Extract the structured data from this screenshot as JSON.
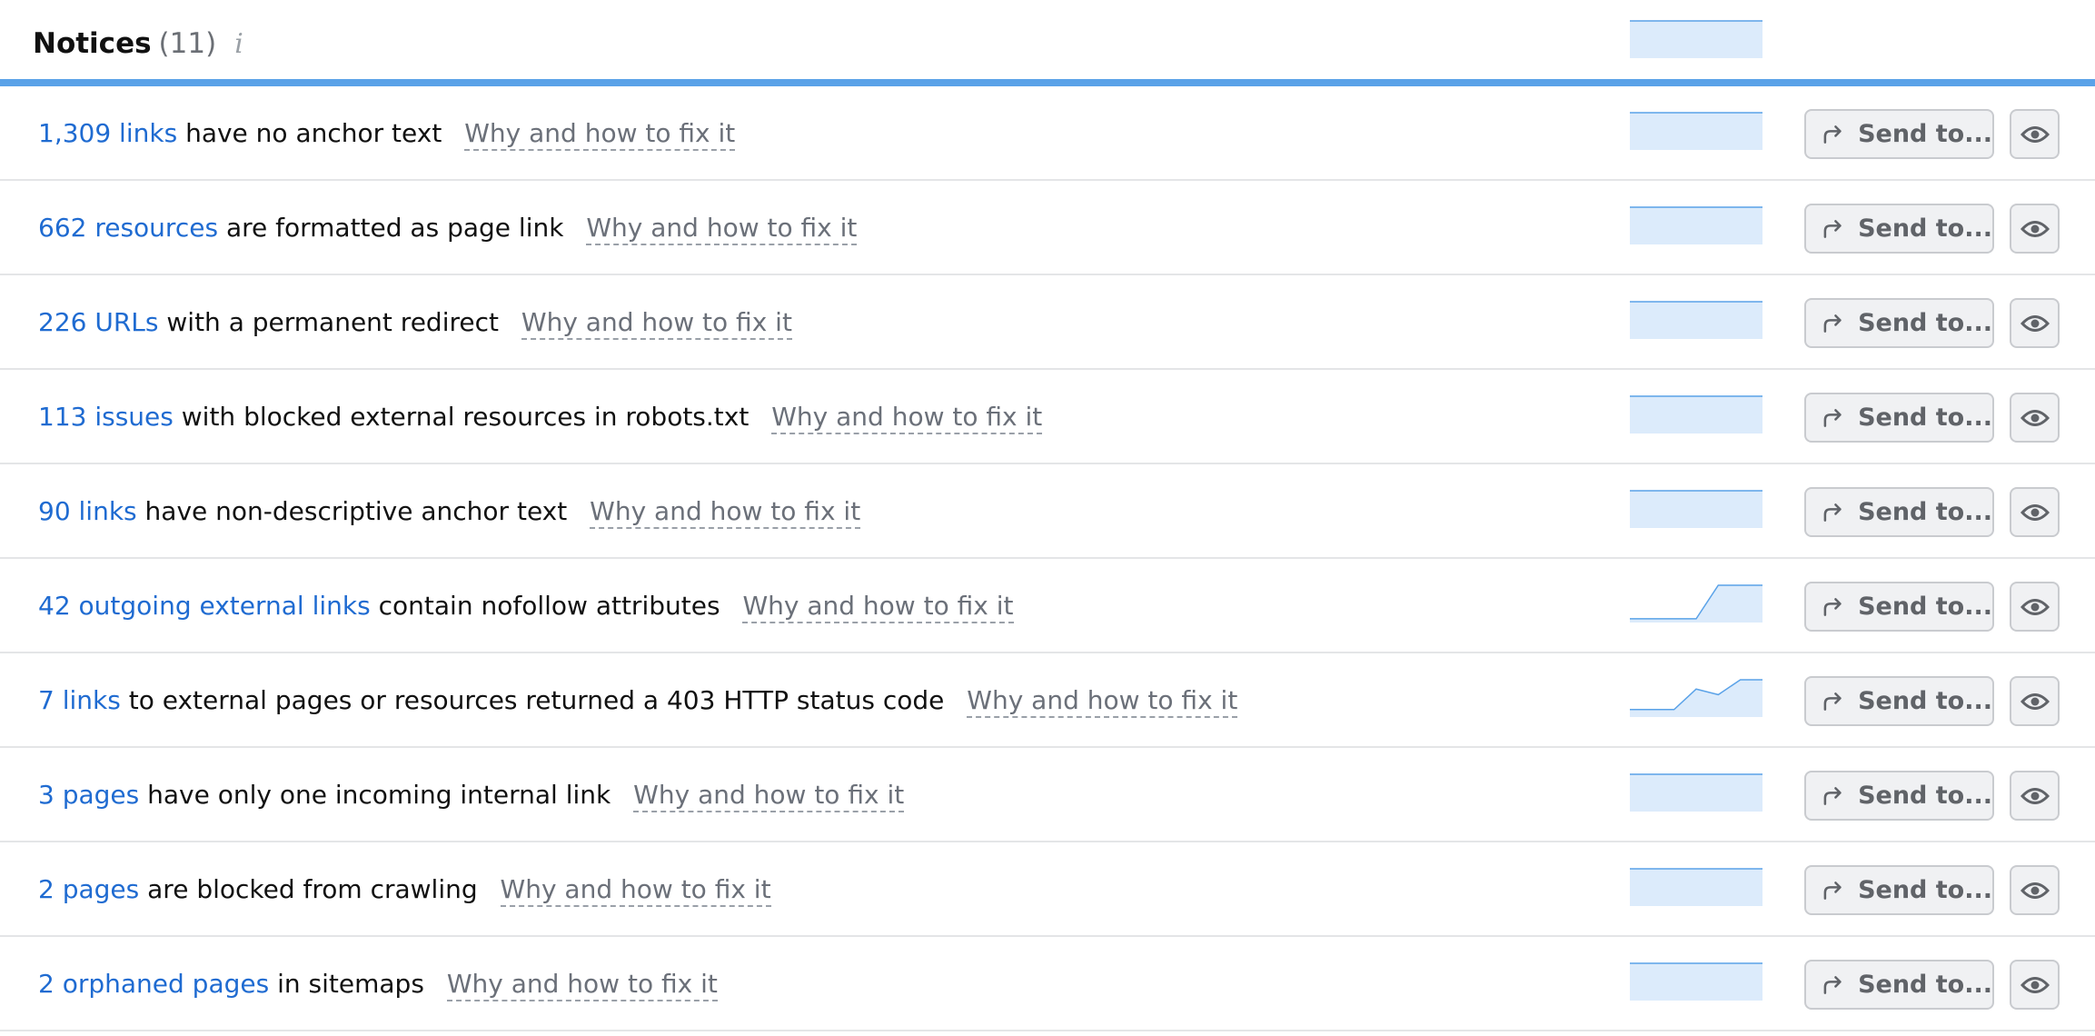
{
  "header": {
    "title": "Notices",
    "count": "(11)",
    "info_icon": "info-icon",
    "sparkline": [
      1,
      1,
      1,
      1,
      1,
      1,
      1
    ]
  },
  "send_label": "Send to...",
  "icons": {
    "send": "share-arrow-icon",
    "view": "eye-icon"
  },
  "colors": {
    "link": "#1f6bd1",
    "accent": "#5aa2e8",
    "sparkline_fill": "#dcebfb"
  },
  "issues": [
    {
      "count": "1,309 links",
      "text": "have no anchor text",
      "fix": "Why and how to fix it",
      "sparkline": [
        1,
        1,
        1,
        1,
        1,
        1,
        1
      ]
    },
    {
      "count": "662 resources",
      "text": "are formatted as page link",
      "fix": "Why and how to fix it",
      "sparkline": [
        1,
        1,
        1,
        1,
        1,
        1,
        1
      ]
    },
    {
      "count": "226 URLs",
      "text": "with a permanent redirect",
      "fix": "Why and how to fix it",
      "sparkline": [
        1,
        1,
        1,
        1,
        1,
        1,
        1
      ]
    },
    {
      "count": "113 issues",
      "text": "with blocked external resources in robots.txt",
      "fix": "Why and how to fix it",
      "sparkline": [
        1,
        1,
        1,
        1,
        1,
        1,
        1
      ]
    },
    {
      "count": "90 links",
      "text": "have non-descriptive anchor text",
      "fix": "Why and how to fix it",
      "sparkline": [
        1,
        1,
        1,
        1,
        1,
        1,
        1
      ]
    },
    {
      "count": "42 outgoing external links",
      "text": "contain nofollow attributes",
      "fix": "Why and how to fix it",
      "sparkline": [
        0.1,
        0.1,
        0.1,
        0.1,
        1,
        1,
        1
      ]
    },
    {
      "count": "7 links",
      "text": "to external pages or resources returned a 403 HTTP status code",
      "fix": "Why and how to fix it",
      "sparkline": [
        0.2,
        0.2,
        0.2,
        0.75,
        0.6,
        1,
        1
      ]
    },
    {
      "count": "3 pages",
      "text": "have only one incoming internal link",
      "fix": "Why and how to fix it",
      "sparkline": [
        1,
        1,
        1,
        1,
        1,
        1,
        1
      ]
    },
    {
      "count": "2 pages",
      "text": "are blocked from crawling",
      "fix": "Why and how to fix it",
      "sparkline": [
        1,
        1,
        1,
        1,
        1,
        1,
        1
      ]
    },
    {
      "count": "2 orphaned pages",
      "text": "in sitemaps",
      "fix": "Why and how to fix it",
      "sparkline": [
        1,
        1,
        1,
        1,
        1,
        1,
        1
      ]
    }
  ]
}
